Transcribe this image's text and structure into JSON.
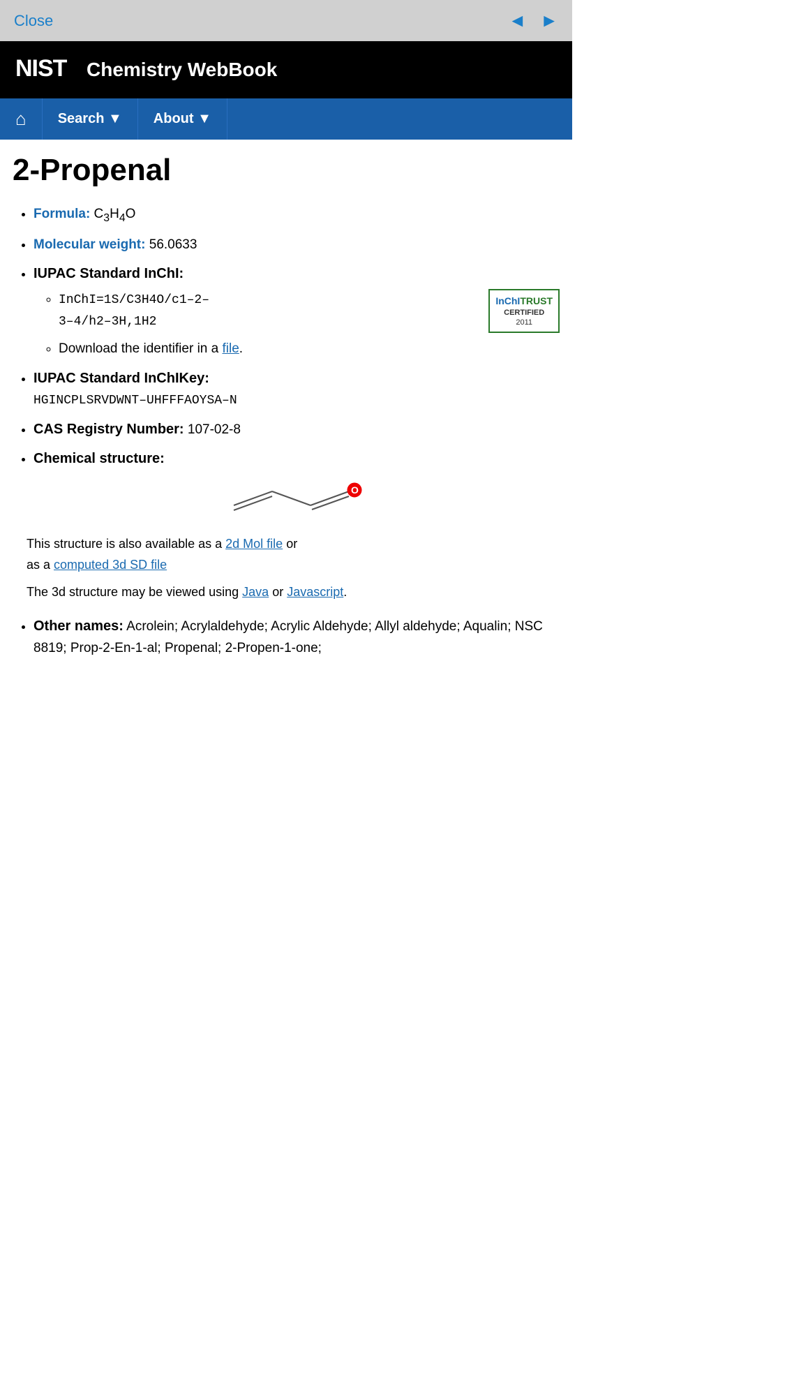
{
  "topbar": {
    "close_label": "Close",
    "back_arrow": "◄",
    "forward_arrow": "►"
  },
  "header": {
    "nist_logo": "NIST",
    "site_title": "Chemistry WebBook"
  },
  "nav": {
    "home_title": "Home",
    "search_label": "Search ▼",
    "about_label": "About ▼"
  },
  "page": {
    "title": "2-Propenal",
    "formula_label": "Formula:",
    "formula_value": "C₃H₄O",
    "molecular_weight_label": "Molecular weight:",
    "molecular_weight_value": "56.0633",
    "iupac_inchi_label": "IUPAC Standard InChI:",
    "inchi_string": "InChI=1S/C3H4O/c1-2-3-4/h2-3H,1H2",
    "inchi_display": "InChI=1S/C3H4O/c1–2–3–4/h2–3H,1H2",
    "download_identifier_text": "Download the identifier in a",
    "download_link_text": "file",
    "download_period": ".",
    "inchi_trust_label": "InChI",
    "inchi_trust_word": "TRUST",
    "inchi_trust_certified": "CERTIFIED",
    "inchi_trust_year": "2011",
    "iupac_inchikey_label": "IUPAC Standard InChIKey:",
    "inchikey_value": "HGINCPLSRVDWNT–UHFFFAOYSA–N",
    "cas_label": "CAS Registry Number:",
    "cas_value": "107-02-8",
    "chemical_structure_label": "Chemical structure:",
    "structure_text_1": "This structure is also available as a",
    "mol_file_link": "2d Mol file",
    "structure_text_2": "or as a",
    "sd_file_link": "computed 3d SD file",
    "structure_text_3": "The 3d structure may be viewed using",
    "java_link": "Java",
    "structure_text_4": "or",
    "javascript_link": "Javascript",
    "structure_text_5": ".",
    "other_names_label": "Other names:",
    "other_names_value": "Acrolein; Acrylaldehyde; Acrylic Aldehyde; Allyl aldehyde; Aqualin; NSC 8819; Prop-2-En-1-al; Propenal; 2-Propen-1-one;"
  }
}
